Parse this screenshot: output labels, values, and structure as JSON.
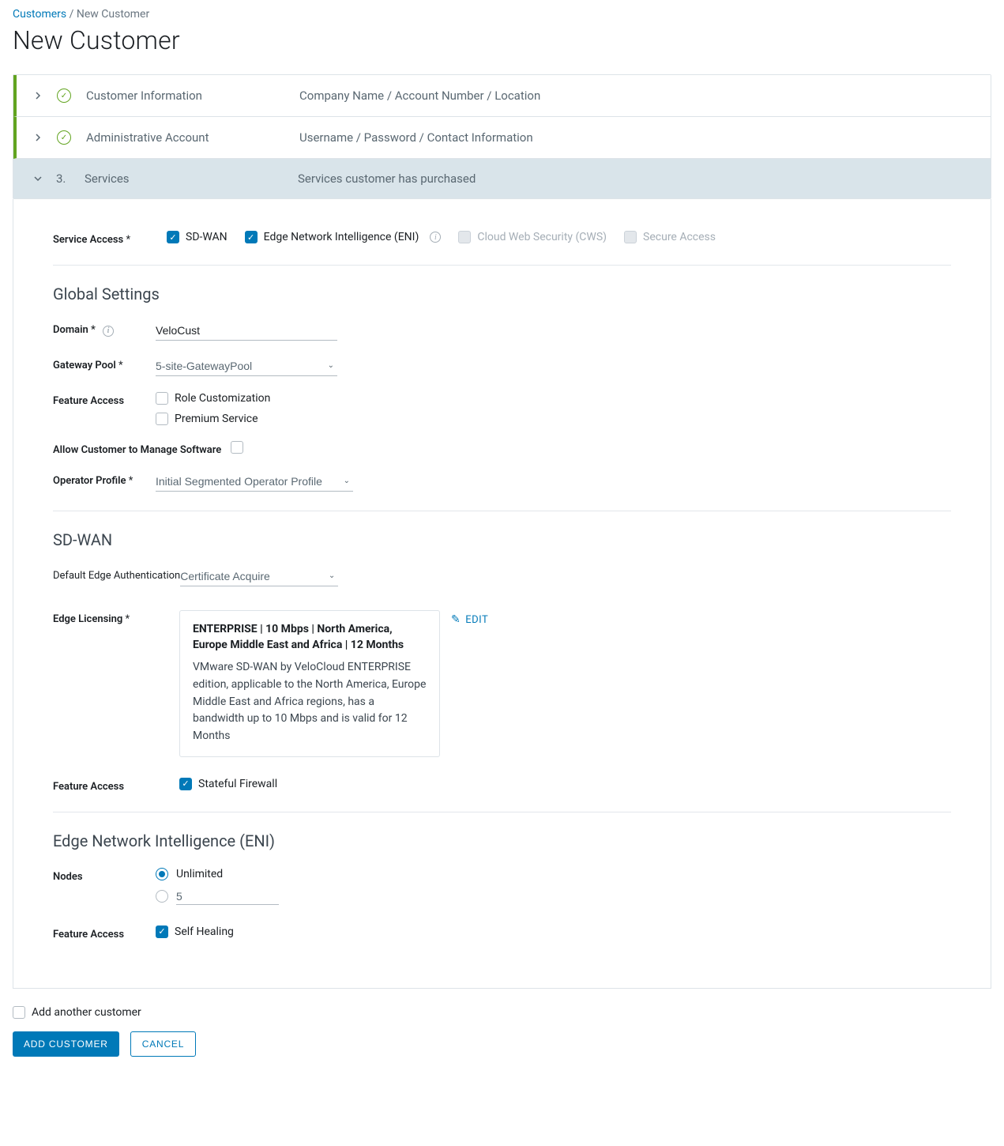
{
  "breadcrumb": {
    "root": "Customers",
    "current": "New Customer"
  },
  "title": "New Customer",
  "steps": [
    {
      "title": "Customer Information",
      "desc": "Company Name / Account Number / Location"
    },
    {
      "title": "Administrative Account",
      "desc": "Username / Password / Contact Information"
    },
    {
      "num": "3.",
      "title": "Services",
      "desc": "Services customer has purchased"
    }
  ],
  "service_access": {
    "label": "Service Access",
    "options": {
      "sdwan": "SD-WAN",
      "eni": "Edge Network Intelligence (ENI)",
      "cws": "Cloud Web Security (CWS)",
      "secure": "Secure Access"
    }
  },
  "global": {
    "heading": "Global Settings",
    "domain_label": "Domain",
    "domain_value": "VeloCust",
    "gateway_label": "Gateway Pool",
    "gateway_value": "5-site-GatewayPool",
    "feature_label": "Feature Access",
    "role_cust": "Role Customization",
    "premium": "Premium Service",
    "allow_manage": "Allow Customer to Manage Software",
    "operator_label": "Operator Profile",
    "operator_value": "Initial Segmented Operator Profile"
  },
  "sdwan": {
    "heading": "SD-WAN",
    "auth_label": "Default Edge Authentication",
    "auth_value": "Certificate Acquire",
    "lic_label": "Edge Licensing",
    "lic_title": "ENTERPRISE | 10 Mbps | North America, Europe Middle East and Africa | 12 Months",
    "lic_desc": "VMware SD-WAN by VeloCloud ENTERPRISE edition, applicable to the North America, Europe Middle East and Africa regions, has a bandwidth up to 10 Mbps and is valid for 12 Months",
    "edit": "EDIT",
    "feature_label": "Feature Access",
    "stateful": "Stateful Firewall"
  },
  "eni": {
    "heading": "Edge Network Intelligence (ENI)",
    "nodes_label": "Nodes",
    "unlimited": "Unlimited",
    "custom_value": "5",
    "feature_label": "Feature Access",
    "self_heal": "Self Healing"
  },
  "footer": {
    "add_another": "Add another customer",
    "add_btn": "ADD CUSTOMER",
    "cancel_btn": "CANCEL"
  }
}
